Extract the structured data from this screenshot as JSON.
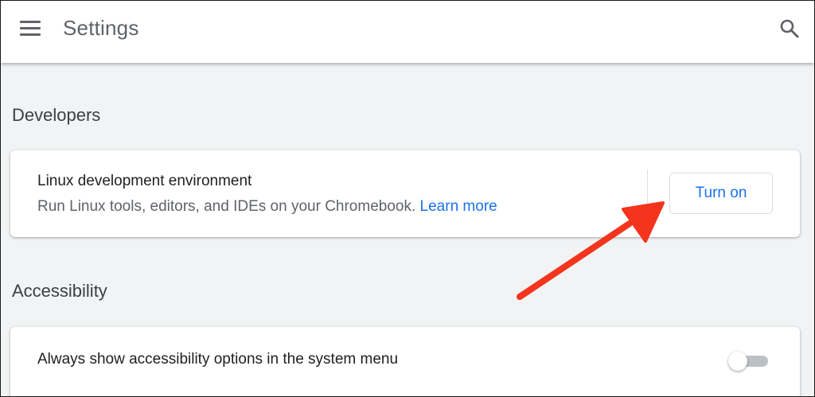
{
  "header": {
    "title": "Settings",
    "menu_icon": "hamburger-menu-icon",
    "search_icon": "search-icon"
  },
  "sections": {
    "developers": {
      "heading": "Developers",
      "linux": {
        "title": "Linux development environment",
        "description": "Run Linux tools, editors, and IDEs on your Chromebook.",
        "learn_more": "Learn more",
        "button_label": "Turn on"
      }
    },
    "accessibility": {
      "heading": "Accessibility",
      "always_show": {
        "label": "Always show accessibility options in the system menu",
        "toggle_on": false
      }
    }
  },
  "annotation": {
    "arrow_color": "#f4341c"
  },
  "colors": {
    "accent": "#1a73e8",
    "background": "#f1f3f4",
    "card": "#ffffff"
  }
}
